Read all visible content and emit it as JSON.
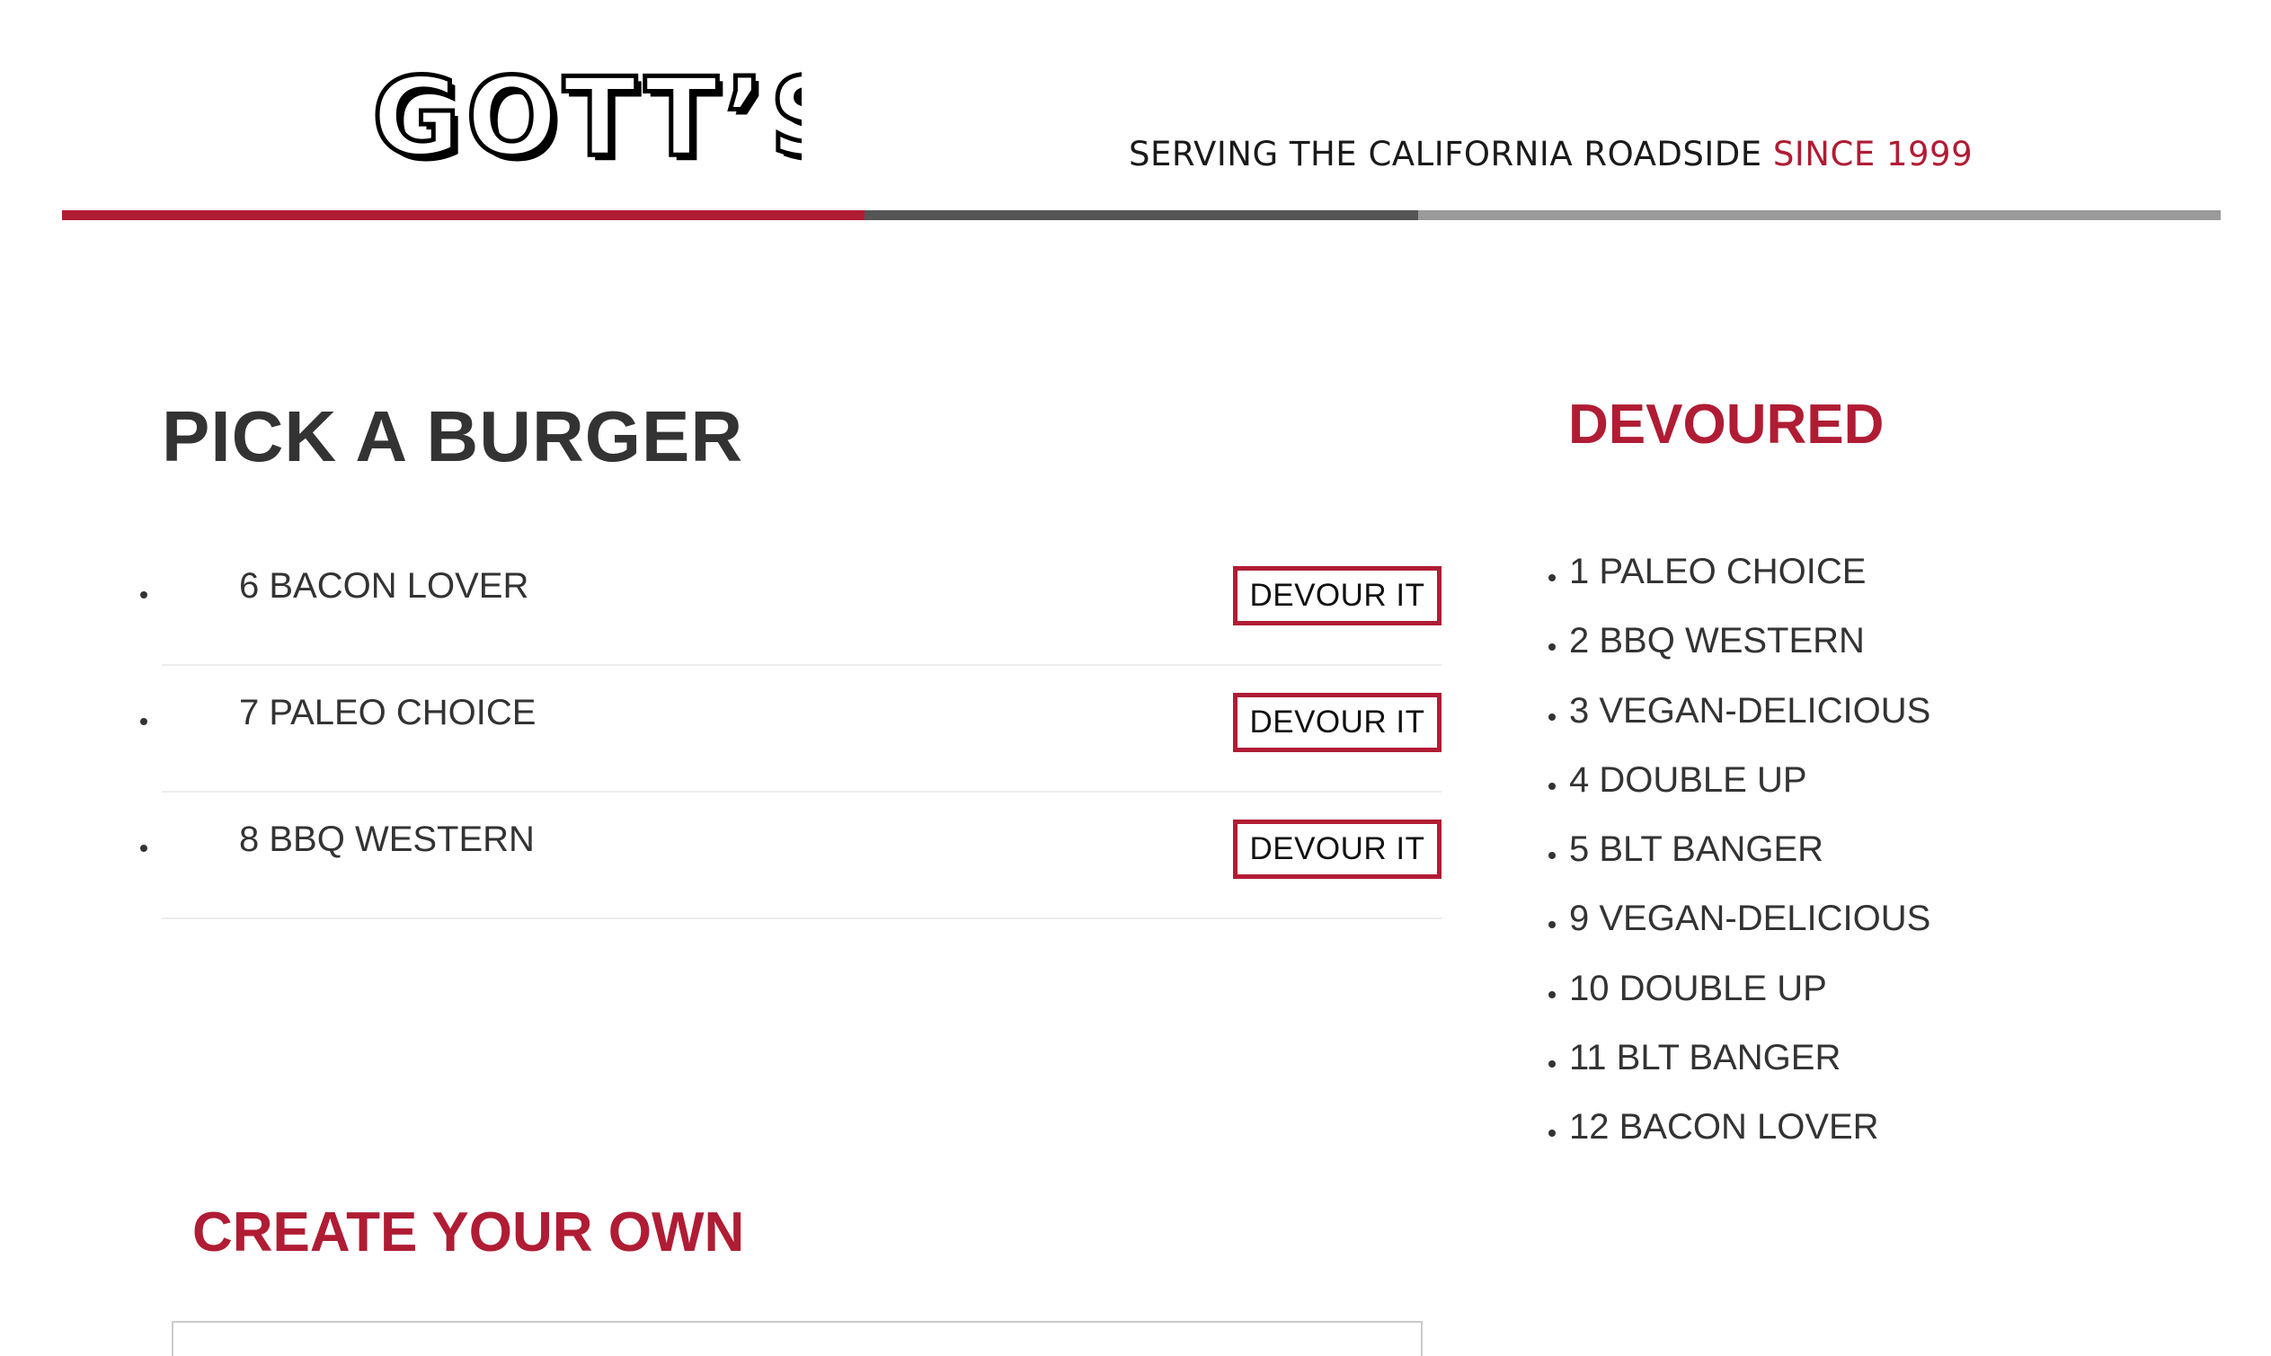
{
  "header": {
    "logo_text": "GOTT'S",
    "tagline_main": "SERVING THE CALIFORNIA ROADSIDE ",
    "tagline_accent": "SINCE 1999"
  },
  "colors": {
    "brand_red": "#b01c34",
    "stripe_dark": "#555555",
    "stripe_grey": "#9a9a9a",
    "text": "#333333"
  },
  "pick": {
    "title": "PICK A BURGER",
    "items": [
      {
        "label": "6 BACON LOVER",
        "button": "DEVOUR IT"
      },
      {
        "label": "7 PALEO CHOICE",
        "button": "DEVOUR IT"
      },
      {
        "label": "8 BBQ WESTERN",
        "button": "DEVOUR IT"
      }
    ]
  },
  "devoured": {
    "title": "DEVOURED",
    "items": [
      "1 PALEO CHOICE",
      "2 BBQ WESTERN",
      "3 VEGAN-DELICIOUS",
      "4 DOUBLE UP",
      "5 BLT BANGER",
      "9 VEGAN-DELICIOUS",
      "10 DOUBLE UP",
      "11 BLT BANGER",
      "12 BACON LOVER"
    ]
  },
  "create": {
    "title": "CREATE YOUR OWN",
    "input_value": ""
  }
}
